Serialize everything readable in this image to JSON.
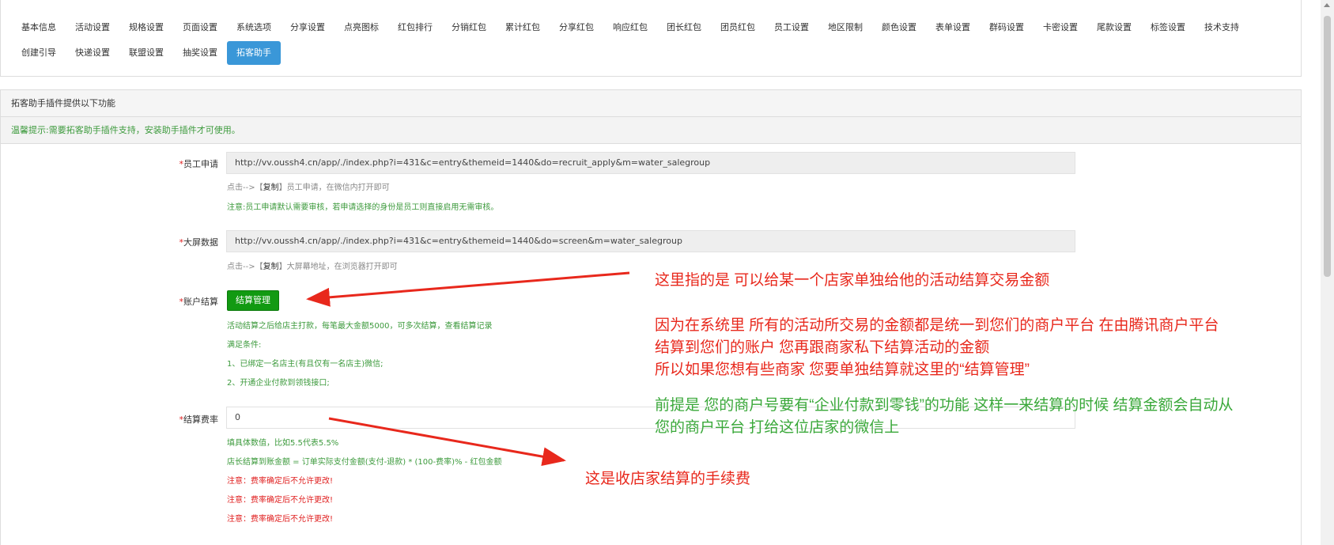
{
  "tabs_row1": [
    "基本信息",
    "活动设置",
    "规格设置",
    "页面设置",
    "系统选项",
    "分享设置",
    "点亮图标",
    "红包排行",
    "分销红包",
    "累计红包",
    "分享红包",
    "响应红包",
    "团长红包",
    "团员红包",
    "员工设置",
    "地区限制",
    "颜色设置",
    "表单设置",
    "群码设置",
    "卡密设置",
    "尾款设置",
    "标签设置",
    "技术支持"
  ],
  "tabs_row2": [
    "创建引导",
    "快递设置",
    "联盟设置",
    "抽奖设置",
    "拓客助手"
  ],
  "panel": {
    "title": "拓客助手插件提供以下功能",
    "tip": "温馨提示:需要拓客助手插件支持，安装助手插件才可使用。"
  },
  "fields": {
    "staff_apply": {
      "label": "员工申请",
      "value": "http://vv.oussh4.cn/app/./index.php?i=431&c=entry&themeid=1440&do=recruit_apply&m=water_salegroup",
      "help_prefix": "点击-->【",
      "help_copy": "复制",
      "help_suffix": "】员工申请，在微信内打开即可",
      "note": "注意:员工申请默认需要审核，若申请选择的身份是员工则直接启用无需审核。"
    },
    "big_screen": {
      "label": "大屏数据",
      "value": "http://vv.oussh4.cn/app/./index.php?i=431&c=entry&themeid=1440&do=screen&m=water_salegroup",
      "help_prefix": "点击-->【",
      "help_copy": "复制",
      "help_suffix": "】大屏幕地址，在浏览器打开即可"
    },
    "settlement": {
      "label": "账户结算",
      "button": "结算管理",
      "lines": [
        "活动结算之后给店主打款，每笔最大金额5000，可多次结算，查看结算记录",
        "满足条件:",
        "1、已绑定一名店主(有且仅有一名店主)微信;",
        "2、开通企业付款到领钱接口;"
      ]
    },
    "fee_rate": {
      "label": "结算费率",
      "value": "0",
      "green_lines": [
        "填具体数值，比如5.5代表5.5%",
        "店长结算到账金额 = 订单实际支付金额(支付-退款) * (100-费率)% - 红包金额"
      ],
      "red_lines": [
        "注意：费率确定后不允许更改!",
        "注意：费率确定后不允许更改!",
        "注意：费率确定后不允许更改!"
      ]
    }
  },
  "annotations": {
    "a1": "这里指的是 可以给某一个店家单独给他的活动结算交易金额",
    "a2": [
      "因为在系统里 所有的活动所交易的金额都是统一到您们的商户平台  在由腾讯商户平台",
      "结算到您们的账户  您再跟商家私下结算活动的金额",
      "所以如果您想有些商家 您要单独结算就这里的“结算管理”"
    ],
    "a3": [
      "前提是 您的商户号要有“企业付款到零钱”的功能  这样一来结算的时候 结算金额会自动从",
      "您的商户平台 打给这位店家的微信上"
    ],
    "a4": "这是收店家结算的手续费"
  },
  "colors": {
    "active_tab": "#3a97d8",
    "button_green": "#129a12",
    "annotation_red": "#e8281c",
    "annotation_green": "#3aa83a",
    "arrow_red": "#e8281c"
  }
}
